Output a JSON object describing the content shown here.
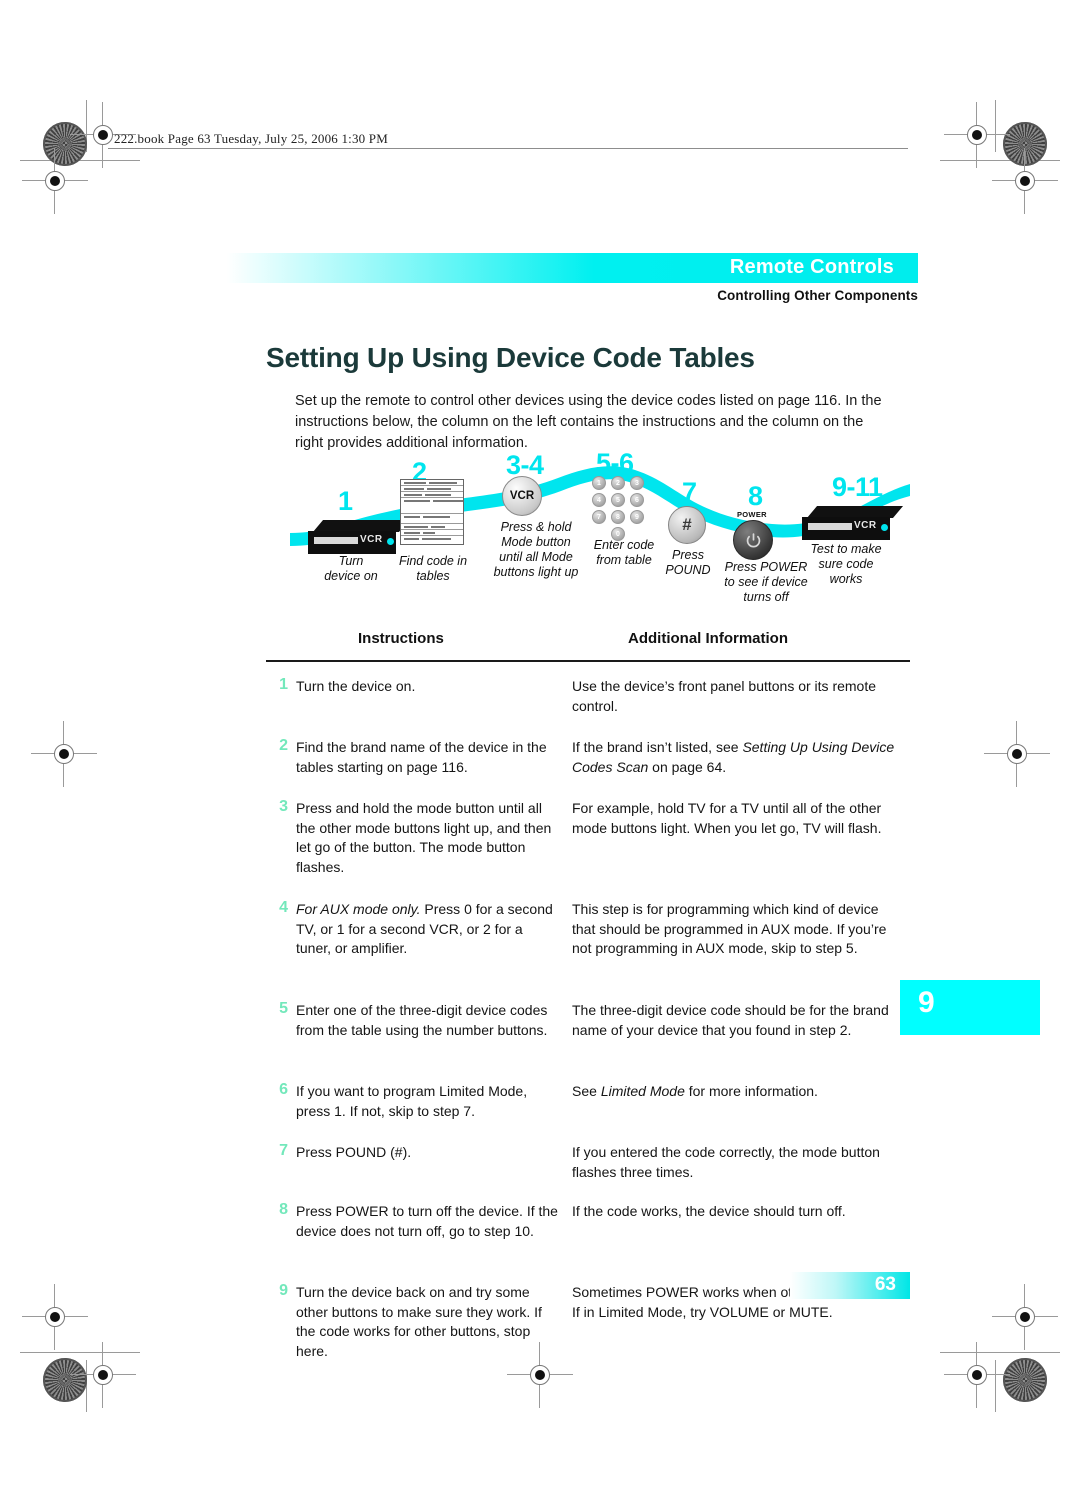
{
  "print_marks": {
    "file_line": "222.book  Page 63  Tuesday, July 25, 2006  1:30 PM"
  },
  "header": {
    "chapter_title": "Remote Controls",
    "section_title": "Controlling Other Components"
  },
  "page_title": "Setting Up Using Device Code Tables",
  "intro": "Set up the remote to control other devices using the device codes listed on page 116. In the instructions below, the column on the left contains the instructions and the column on the right provides additional information.",
  "diagram": {
    "steps": [
      {
        "number": "1",
        "caption": "Turn\ndevice on",
        "icon": "vcr-device-icon"
      },
      {
        "number": "2",
        "caption": "Find code in\ntables",
        "icon": "code-table-icon"
      },
      {
        "number": "3-4",
        "caption": "Press & hold\nMode button\nuntil all Mode\nbuttons light up",
        "icon": "vcr-mode-button-icon",
        "button_label": "VCR"
      },
      {
        "number": "5-6",
        "caption": "Enter code\nfrom table",
        "icon": "number-keypad-icon"
      },
      {
        "number": "7",
        "caption": "Press\nPOUND",
        "icon": "pound-button-icon",
        "button_label": "#"
      },
      {
        "number": "8",
        "caption": "Press POWER\nto see if device\nturns off",
        "icon": "power-button-icon",
        "button_label": "POWER"
      },
      {
        "number": "9-11",
        "caption": "Test to make\nsure code\nworks",
        "icon": "vcr-device-icon"
      }
    ],
    "keypad_keys": [
      "1",
      "2",
      "3",
      "4",
      "5",
      "6",
      "7",
      "8",
      "9",
      "0"
    ],
    "device_label": "VCR"
  },
  "table": {
    "col_instructions": "Instructions",
    "col_additional": "Additional Information",
    "rows": [
      {
        "number": "1",
        "instruction": "Turn the device on.",
        "additional": "Use the device’s front panel buttons or its remote control."
      },
      {
        "number": "2",
        "instruction": "Find the brand name of the device in the tables starting on page 116.",
        "additional_pre": "If the brand isn’t listed, see ",
        "additional_em": "Setting Up Using Device Codes Scan",
        "additional_post": " on page 64."
      },
      {
        "number": "3",
        "instruction": "Press and hold the mode button until all the other mode buttons light up, and then let go of the button. The mode button flashes.",
        "additional": "For example, hold TV for a TV until all of the other mode buttons light. When you let go, TV will flash."
      },
      {
        "number": "4",
        "instruction_em": "For AUX mode only.",
        "instruction_post": " Press 0 for a second TV, or 1 for a second VCR, or 2 for a tuner, or amplifier.",
        "additional": "This step is for programming which kind of device that should be programmed in AUX mode. If you’re not programming in AUX mode, skip to step 5."
      },
      {
        "number": "5",
        "instruction": "Enter one of the three-digit device codes from the table using the number buttons.",
        "additional": "The three-digit device code should be for the brand name of your device that you found in step 2."
      },
      {
        "number": "6",
        "instruction": "If you want to program Limited Mode, press 1. If not, skip to step 7.",
        "additional_pre": "See ",
        "additional_em": "Limited Mode",
        "additional_post": " for more information."
      },
      {
        "number": "7",
        "instruction": "Press POUND (#).",
        "additional": "If you entered the code correctly, the mode button flashes three times."
      },
      {
        "number": "8",
        "instruction": "Press POWER to turn off the device. If the device does not turn off, go to step 10.",
        "additional": "If the code works, the device should turn off."
      },
      {
        "number": "9",
        "instruction": "Turn the device back on and try some other buttons to make sure they work. If the code works for other buttons, stop here.",
        "additional": "Sometimes POWER works when other buttons don’t. If in Limited Mode, try VOLUME or MUTE."
      }
    ]
  },
  "thumb_tab": "9",
  "folio": "63",
  "colors": {
    "accent_cyan": "#00ffff",
    "header_cyan": "#00f0f0",
    "step_number_green": "#73e8bb",
    "diagram_number_cyan": "#00e5ee",
    "title_dark": "#1b3a3a"
  }
}
